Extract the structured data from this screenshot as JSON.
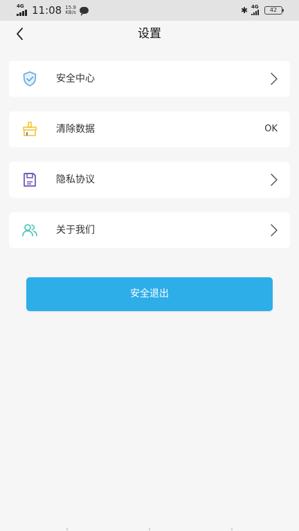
{
  "status_bar": {
    "network": "4G",
    "time": "11:08",
    "speed_value": "15.9",
    "speed_unit": "KB/s",
    "bluetooth_icon": "bluetooth-icon",
    "signal_label": "4G",
    "battery": "42"
  },
  "nav": {
    "title": "设置",
    "back_icon": "back-arrow-icon"
  },
  "menu": [
    {
      "label": "安全中心",
      "icon": "shield-check-icon",
      "icon_color": "#5aa9e6",
      "trailing": "chevron"
    },
    {
      "label": "清除数据",
      "icon": "broom-icon",
      "icon_color": "#f2c434",
      "trailing": "value",
      "value": "OK"
    },
    {
      "label": "隐私协议",
      "icon": "save-document-icon",
      "icon_color": "#6a4fb3",
      "trailing": "chevron"
    },
    {
      "label": "关于我们",
      "icon": "users-icon",
      "icon_color": "#36c4b3",
      "trailing": "chevron"
    }
  ],
  "logout": {
    "label": "安全退出",
    "color": "#2eaee9"
  }
}
